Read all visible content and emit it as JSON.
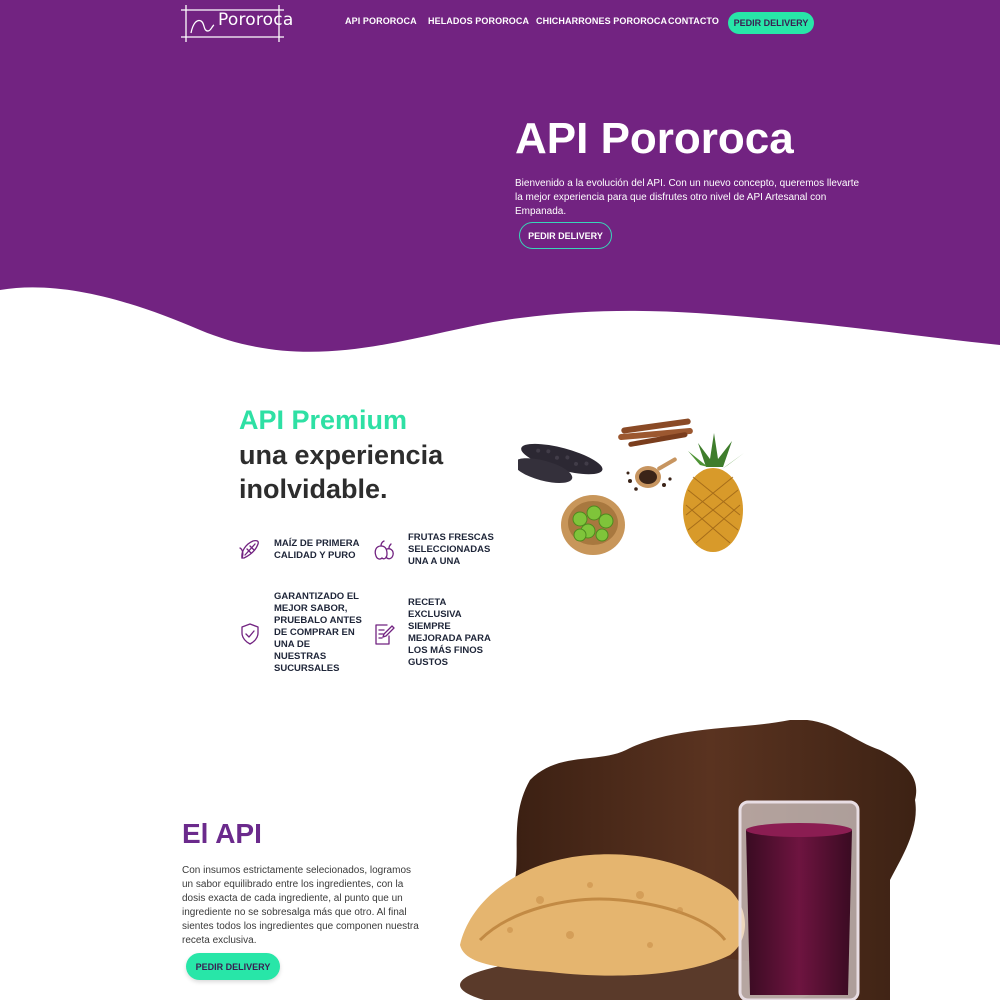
{
  "colors": {
    "primary_purple": "#722381",
    "accent_green": "#28e6a8",
    "heading_purple": "#6b2a8c"
  },
  "brand": {
    "name": "Pororoca"
  },
  "nav": {
    "items": [
      {
        "label": "API POROROCA"
      },
      {
        "label": "HELADOS POROROCA"
      },
      {
        "label": "CHICHARRONES POROROCA"
      },
      {
        "label": "CONTACTO"
      }
    ],
    "cta_label": "PEDIR DELIVERY"
  },
  "hero": {
    "title": "API Pororoca",
    "text": "Bienvenido a la evolución del API. Con un nuevo concepto, queremos llevarte la mejor experiencia para que disfrutes otro nivel de API Artesanal con Empanada.",
    "cta_label": "PEDIR DELIVERY"
  },
  "premium": {
    "title": "API Premium",
    "subtitle": "una experiencia inolvidable.",
    "features": [
      {
        "icon": "corn-icon",
        "text": "MAÍZ DE PRIMERA CALIDAD Y PURO"
      },
      {
        "icon": "fruits-icon",
        "text": "FRUTAS FRESCAS SELECCIONADAS UNA A UNA"
      },
      {
        "icon": "shield-check-icon",
        "text": "GARANTIZADO EL MEJOR SABOR, PRUEBALO ANTES DE COMPRAR EN UNA DE NUESTRAS SUCURSALES"
      },
      {
        "icon": "recipe-edit-icon",
        "text": "RECETA EXCLUSIVA SIEMPRE MEJORADA PARA LOS MÁS FINOS GUSTOS"
      }
    ]
  },
  "el_api": {
    "title": "El API",
    "text": "Con insumos estrictamente selecionados, logramos un sabor equilibrado entre los ingredientes, con la dosis exacta de cada ingrediente, al punto que un ingrediente no se sobresalga más que otro. Al final sientes todos los ingredientes que componen nuestra receta exclusiva.",
    "cta_label": "PEDIR DELIVERY"
  }
}
